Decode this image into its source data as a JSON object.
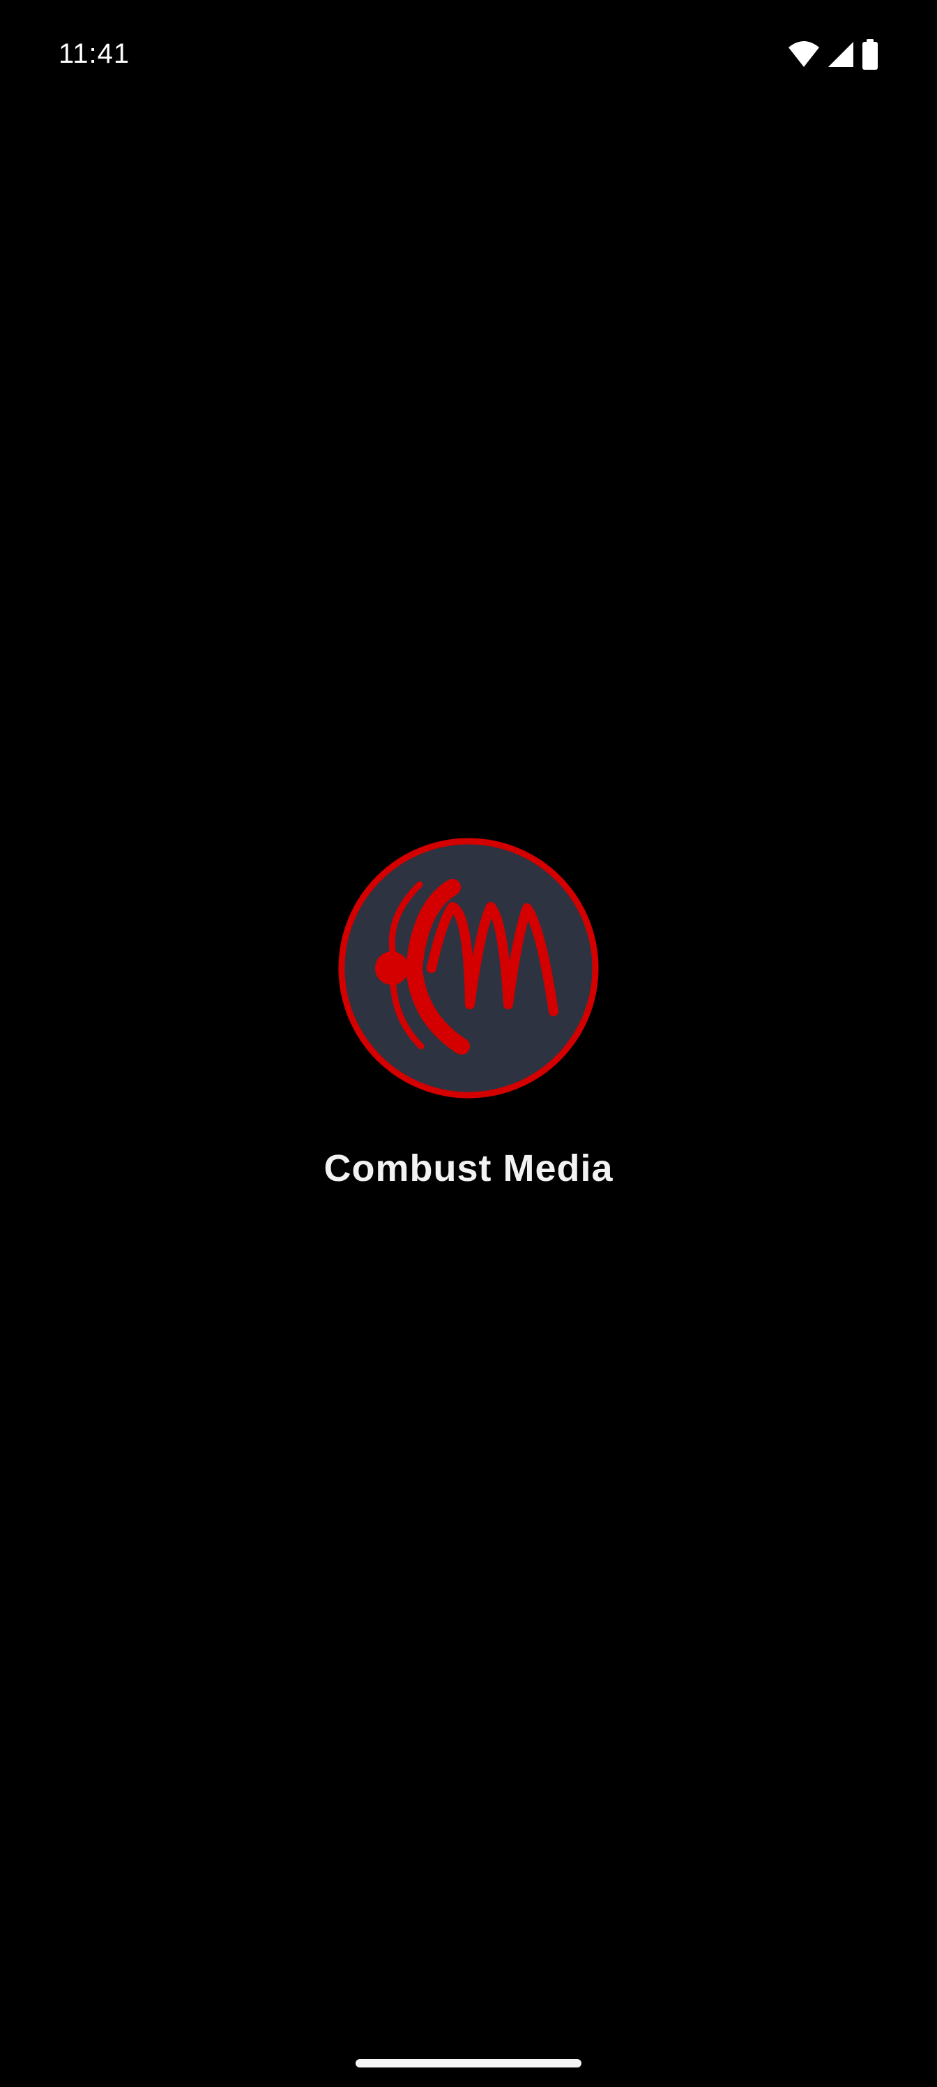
{
  "status_bar": {
    "time": "11:41",
    "icons": [
      "wifi-icon",
      "cell-signal-icon",
      "battery-icon"
    ]
  },
  "splash": {
    "logo": {
      "icon": "combust-media-logo",
      "ring_color": "#d40000",
      "fill_color": "#2d3340",
      "mark_color": "#d40000"
    },
    "app_name": "Combust Media"
  },
  "theme": {
    "background": "#000000",
    "text": "#f2f2f2"
  }
}
